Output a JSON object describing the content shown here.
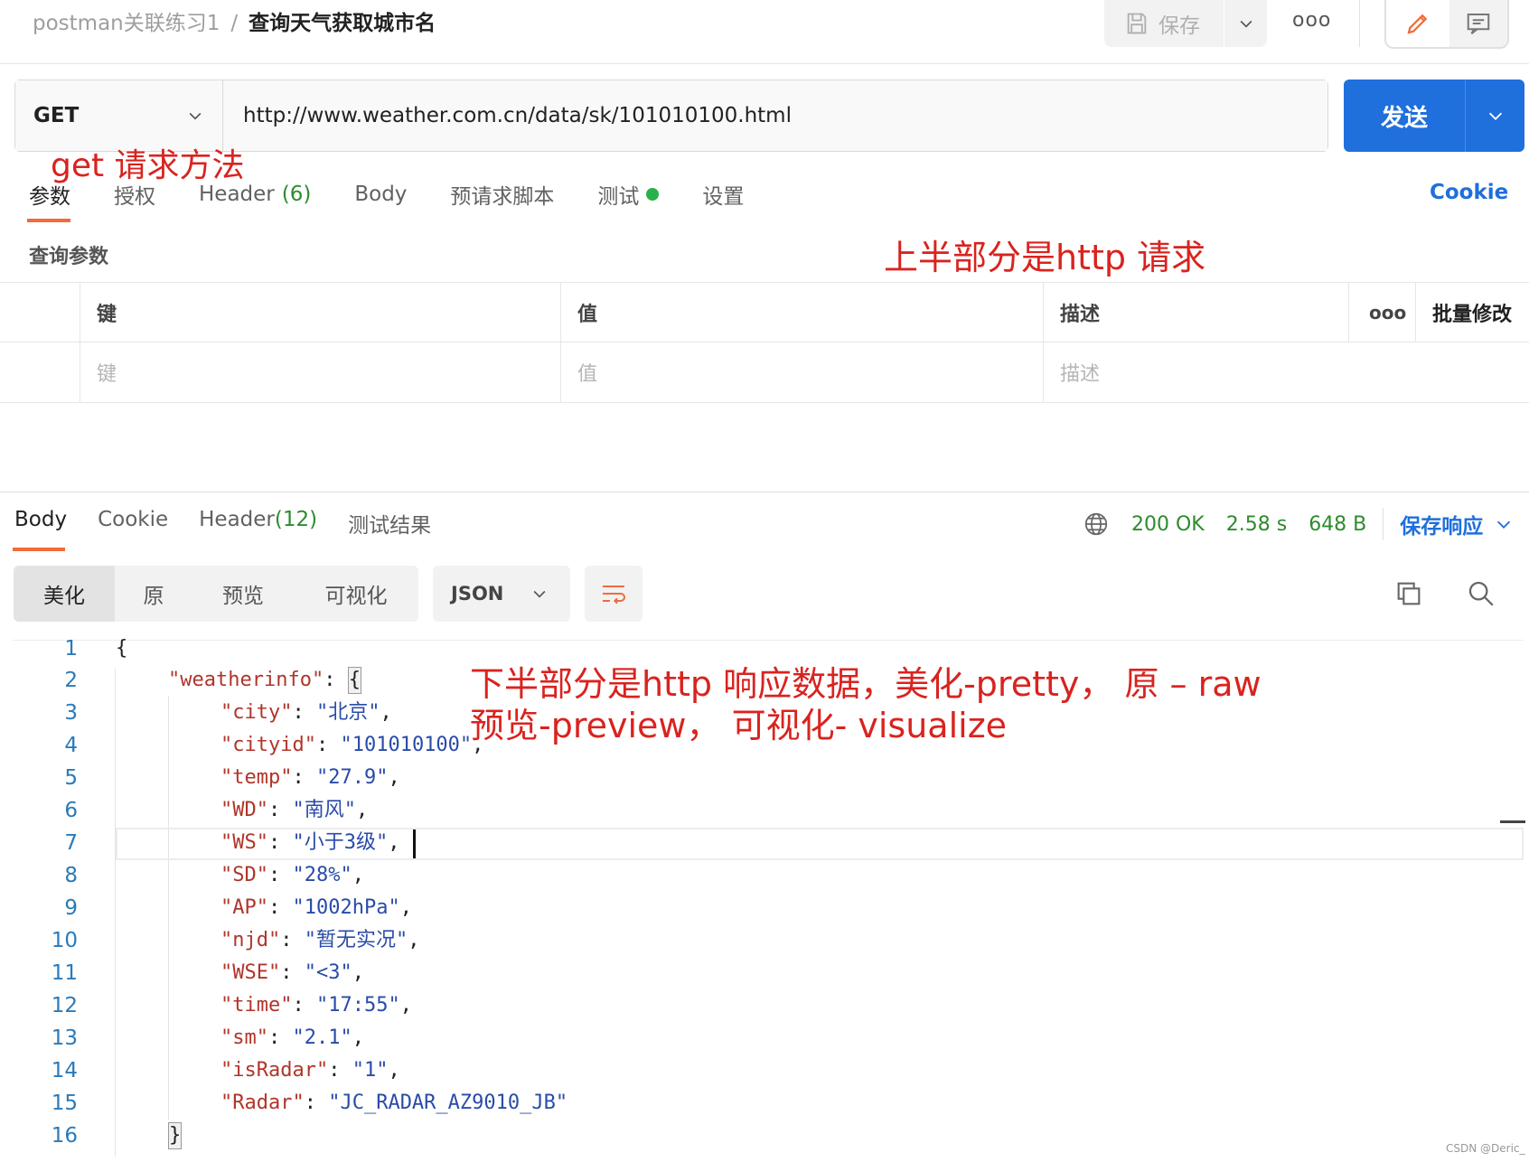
{
  "header": {
    "collection": "postman关联练习1",
    "separator": "/",
    "request_name": "查询天气获取城市名",
    "save_label": "保存",
    "more_label": "ooo"
  },
  "request": {
    "method": "GET",
    "url": "http://www.weather.com.cn/data/sk/101010100.html",
    "send_label": "发送",
    "tabs": [
      {
        "label": "参数"
      },
      {
        "label": "授权"
      },
      {
        "label": "Header",
        "count": "(6)"
      },
      {
        "label": "Body"
      },
      {
        "label": "预请求脚本"
      },
      {
        "label": "测试"
      },
      {
        "label": "设置"
      }
    ],
    "cookie_label": "Cookie",
    "query_title": "查询参数",
    "params_table": {
      "headers": [
        "键",
        "值",
        "描述",
        "ooo",
        "批量修改"
      ],
      "placeholders": [
        "键",
        "值",
        "描述"
      ]
    }
  },
  "response": {
    "tabs": [
      {
        "label": "Body"
      },
      {
        "label": "Cookie"
      },
      {
        "label": "Header",
        "count": "(12)"
      },
      {
        "label": "测试结果"
      }
    ],
    "status": "200 OK",
    "time": "2.58 s",
    "size": "648 B",
    "save_response_label": "保存响应",
    "views": [
      "美化",
      "原",
      "预览",
      "可视化"
    ],
    "format": "JSON",
    "lines": [
      {
        "n": "1",
        "text": "{"
      },
      {
        "n": "2",
        "key": "\"weatherinfo\"",
        "after": ": ",
        "brace": "{"
      },
      {
        "n": "3",
        "key": "\"city\"",
        "value": "\"北京\"",
        "end": ","
      },
      {
        "n": "4",
        "key": "\"cityid\"",
        "value": "\"101010100\"",
        "end": ","
      },
      {
        "n": "5",
        "key": "\"temp\"",
        "value": "\"27.9\"",
        "end": ","
      },
      {
        "n": "6",
        "key": "\"WD\"",
        "value": "\"南风\"",
        "end": ","
      },
      {
        "n": "7",
        "key": "\"WS\"",
        "value": "\"小于3级\"",
        "end": ","
      },
      {
        "n": "8",
        "key": "\"SD\"",
        "value": "\"28%\"",
        "end": ","
      },
      {
        "n": "9",
        "key": "\"AP\"",
        "value": "\"1002hPa\"",
        "end": ","
      },
      {
        "n": "10",
        "key": "\"njd\"",
        "value": "\"暂无实况\"",
        "end": ","
      },
      {
        "n": "11",
        "key": "\"WSE\"",
        "value": "\"<3\"",
        "end": ","
      },
      {
        "n": "12",
        "key": "\"time\"",
        "value": "\"17:55\"",
        "end": ","
      },
      {
        "n": "13",
        "key": "\"sm\"",
        "value": "\"2.1\"",
        "end": ","
      },
      {
        "n": "14",
        "key": "\"isRadar\"",
        "value": "\"1\"",
        "end": ","
      },
      {
        "n": "15",
        "key": "\"Radar\"",
        "value": "\"JC_RADAR_AZ9010_JB\"",
        "end": ""
      },
      {
        "n": "16",
        "text": "}"
      }
    ]
  },
  "annotations": {
    "method_note": "get 请求方法",
    "request_note": "上半部分是http 请求",
    "response_note_1": "下半部分是http 响应数据，美化-pretty， 原 – raw",
    "response_note_2": "预览-preview， 可视化- visualize"
  },
  "watermark": "CSDN @Deric_",
  "colors": {
    "accent_blue": "#1f6fdc",
    "tab_underline": "#f26b3a",
    "status_green": "#2e8b2e",
    "annotation_red": "#d9231f",
    "json_key": "#b0352a",
    "json_string": "#2a4ba8"
  }
}
